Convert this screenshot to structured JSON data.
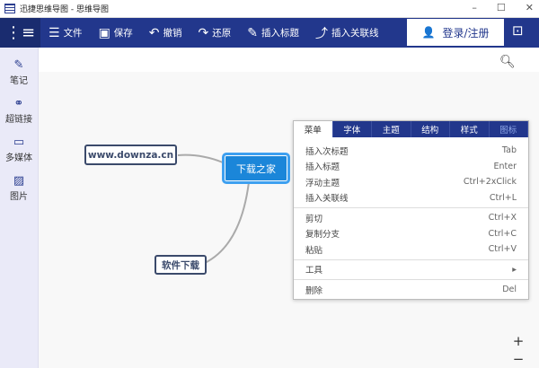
{
  "window": {
    "title": "迅捷思维导图 - 思维导图",
    "minimize": "–",
    "maximize": "☐",
    "close": "✕"
  },
  "toolbar": {
    "items": [
      {
        "icon": "menu-icon",
        "glyph": "☰",
        "label": "文件"
      },
      {
        "icon": "save-icon",
        "glyph": "▣",
        "label": "保存"
      },
      {
        "icon": "undo-icon",
        "glyph": "↶",
        "label": "撤销"
      },
      {
        "icon": "redo-icon",
        "glyph": "↷",
        "label": "还原"
      },
      {
        "icon": "tag-icon",
        "glyph": "✎",
        "label": "插入标题"
      },
      {
        "icon": "link-icon",
        "glyph": "⤴",
        "label": "插入关联线"
      }
    ],
    "login": "登录/注册"
  },
  "sidebar": {
    "items": [
      {
        "glyph": "✎",
        "label": "笔记"
      },
      {
        "glyph": "⚭",
        "label": "超链接"
      },
      {
        "glyph": "▭",
        "label": "多媒体"
      },
      {
        "glyph": "▨",
        "label": "图片"
      }
    ]
  },
  "mindmap": {
    "root": "下载之家",
    "children": [
      "www.downza.cn",
      "软件下载"
    ]
  },
  "context_menu": {
    "tabs": [
      "菜单",
      "字体",
      "主题",
      "结构",
      "样式",
      "图标"
    ],
    "groups": [
      [
        {
          "label": "插入次标题",
          "shortcut": "Tab"
        },
        {
          "label": "插入标题",
          "shortcut": "Enter"
        },
        {
          "label": "浮动主题",
          "shortcut": "Ctrl+2xClick"
        },
        {
          "label": "插入关联线",
          "shortcut": "Ctrl+L"
        }
      ],
      [
        {
          "label": "剪切",
          "shortcut": "Ctrl+X"
        },
        {
          "label": "复制分支",
          "shortcut": "Ctrl+C"
        },
        {
          "label": "粘贴",
          "shortcut": "Ctrl+V"
        }
      ],
      [
        {
          "label": "工具",
          "shortcut": "▸"
        }
      ],
      [
        {
          "label": "删除",
          "shortcut": "Del"
        }
      ]
    ]
  },
  "zoom": {
    "in": "+",
    "out": "−"
  }
}
